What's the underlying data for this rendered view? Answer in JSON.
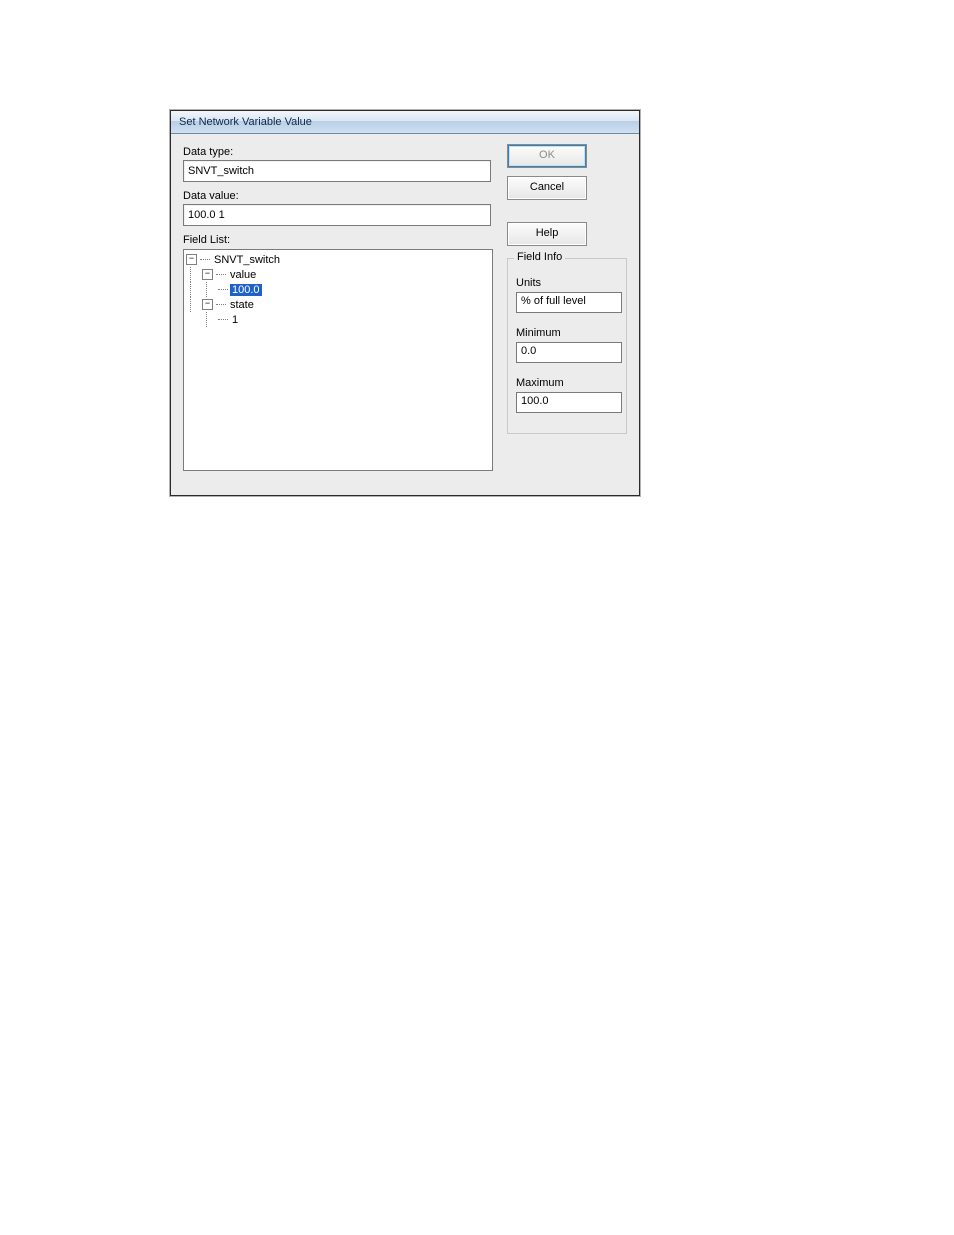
{
  "dialog": {
    "title": "Set Network Variable Value",
    "labels": {
      "data_type": "Data type:",
      "data_value": "Data value:",
      "field_list": "Field List:",
      "field_info": "Field Info",
      "units": "Units",
      "minimum": "Minimum",
      "maximum": "Maximum"
    },
    "buttons": {
      "ok": "OK",
      "cancel": "Cancel",
      "help": "Help"
    },
    "values": {
      "data_type": "SNVT_switch",
      "data_value": "100.0 1",
      "units": "% of full level",
      "minimum": "0.0",
      "maximum": "100.0"
    },
    "tree": {
      "root": "SNVT_switch",
      "value_label": "value",
      "value_data": "100.0",
      "state_label": "state",
      "state_data": "1"
    },
    "toggle_minus": "−"
  }
}
